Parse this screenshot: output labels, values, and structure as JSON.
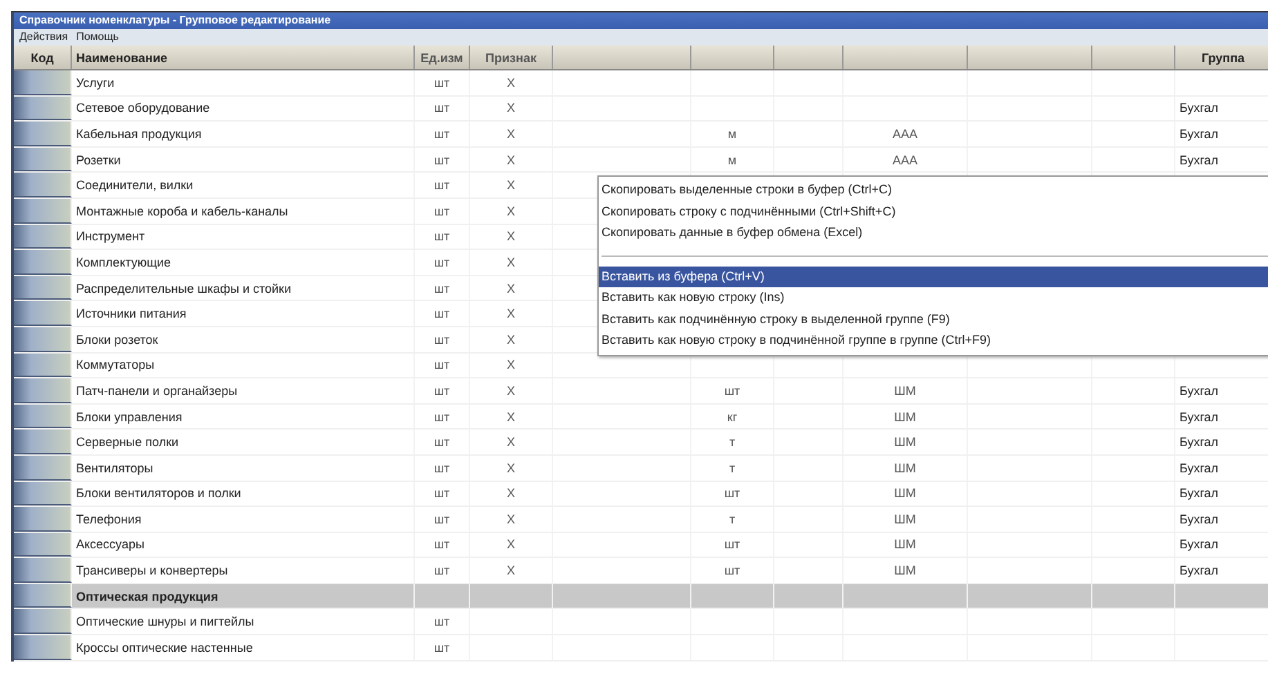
{
  "window": {
    "title": "Справочник номенклатуры - Групповое редактирование"
  },
  "menu_bar": [
    "Действия",
    "Помощь"
  ],
  "table": {
    "columns": [
      "Код",
      "Наименование",
      "Ед.изм",
      "Признак",
      "",
      "",
      "",
      "",
      "",
      "",
      "Группа"
    ],
    "rows": [
      {
        "kind": "item",
        "name": "Услуги",
        "unit": "шт",
        "flag": "Х"
      },
      {
        "kind": "item",
        "name": "Сетевое оборудование",
        "unit": "шт",
        "flag": "Х",
        "group": "Бухгал"
      },
      {
        "kind": "item",
        "name": "Кабельная продукция",
        "unit": "шт",
        "flag": "Х",
        "qty": "м",
        "code": "ААА",
        "group": "Бухгал"
      },
      {
        "kind": "item",
        "name": "Розетки",
        "unit": "шт",
        "flag": "Х",
        "qty": "м",
        "code": "ААА",
        "group": "Бухгал"
      },
      {
        "kind": "item",
        "name": "Соединители, вилки",
        "unit": "шт",
        "flag": "Х"
      },
      {
        "kind": "item",
        "name": "Монтажные короба и кабель-каналы",
        "unit": "шт",
        "flag": "Х"
      },
      {
        "kind": "item",
        "name": "Инструмент",
        "unit": "шт",
        "flag": "Х"
      },
      {
        "kind": "item",
        "name": "Комплектующие",
        "unit": "шт",
        "flag": "Х"
      },
      {
        "kind": "item",
        "name": "Распределительные шкафы и стойки",
        "unit": "шт",
        "flag": "Х"
      },
      {
        "kind": "item",
        "name": "Источники питания",
        "unit": "шт",
        "flag": "Х"
      },
      {
        "kind": "item",
        "name": "Блоки розеток",
        "unit": "шт",
        "flag": "Х"
      },
      {
        "kind": "item",
        "name": "Коммутаторы",
        "unit": "шт",
        "flag": "Х"
      },
      {
        "kind": "item",
        "name": "Патч-панели и органайзеры",
        "unit": "шт",
        "flag": "Х",
        "qty": "шт",
        "code": "ШМ",
        "group": "Бухгал"
      },
      {
        "kind": "item",
        "name": "Блоки управления",
        "unit": "шт",
        "flag": "Х",
        "qty": "кг",
        "code": "ШМ",
        "group": "Бухгал"
      },
      {
        "kind": "item",
        "name": "Серверные полки",
        "unit": "шт",
        "flag": "Х",
        "qty": "т",
        "code": "ШМ",
        "group": "Бухгал"
      },
      {
        "kind": "item",
        "name": "Вентиляторы",
        "unit": "шт",
        "flag": "Х",
        "qty": "т",
        "code": "ШМ",
        "group": "Бухгал"
      },
      {
        "kind": "item",
        "name": "Блоки вентиляторов и полки",
        "unit": "шт",
        "flag": "Х",
        "qty": "шт",
        "code": "ШМ",
        "group": "Бухгал"
      },
      {
        "kind": "item",
        "name": "Телефония",
        "unit": "шт",
        "flag": "Х",
        "qty": "т",
        "code": "ШМ",
        "group": "Бухгал"
      },
      {
        "kind": "item",
        "name": "Аксессуары",
        "unit": "шт",
        "flag": "Х",
        "qty": "шт",
        "code": "ШМ",
        "group": "Бухгал"
      },
      {
        "kind": "item",
        "name": "Трансиверы и конвертеры",
        "unit": "шт",
        "flag": "Х",
        "qty": "шт",
        "code": "ШМ",
        "group": "Бухгал"
      },
      {
        "kind": "group",
        "name": "Оптическая продукция"
      },
      {
        "kind": "item",
        "name": "Оптические шнуры и пигтейлы",
        "unit": "шт"
      },
      {
        "kind": "item",
        "name": "Кроссы оптические настенные",
        "unit": "шт"
      }
    ]
  },
  "context_menu": [
    {
      "kind": "item",
      "label": "Скопировать выделенные строки в буфер (Ctrl+C)",
      "selected": false
    },
    {
      "kind": "item",
      "label": "Скопировать строку с подчинёнными (Ctrl+Shift+C)",
      "selected": false
    },
    {
      "kind": "item",
      "label": "Скопировать данные в буфер обмена (Excel)",
      "selected": false
    },
    {
      "kind": "separator"
    },
    {
      "kind": "item",
      "label": "Вставить из буфера (Ctrl+V)",
      "selected": true
    },
    {
      "kind": "item",
      "label": "Вставить как новую строку (Ins)",
      "selected": false
    },
    {
      "kind": "item",
      "label": "Вставить как подчинённую строку в выделенной группе (F9)",
      "selected": false
    },
    {
      "kind": "item",
      "label": "Вставить как новую строку в подчинённой группе в группе (Ctrl+F9)",
      "selected": false
    }
  ]
}
